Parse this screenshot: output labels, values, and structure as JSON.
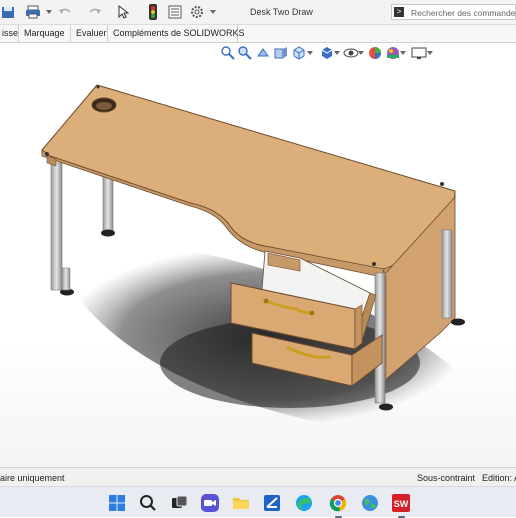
{
  "window": {
    "title": "Desk Two Draw",
    "search_placeholder": "Rechercher des commandes"
  },
  "toolbar_icons": [
    "save-icon",
    "print-icon",
    "undo-icon",
    "redo-icon",
    "select-arrow-icon",
    "rebuild-traffic-light-icon",
    "file-properties-icon",
    "options-gear-icon"
  ],
  "tabs": [
    {
      "label": "isse"
    },
    {
      "label": "Marquage"
    },
    {
      "label": "Evaluer"
    },
    {
      "label": "Compléments de SOLIDWORKS"
    }
  ],
  "headsup_icons": [
    "zoom-to-fit-icon",
    "zoom-to-area-icon",
    "previous-view-icon",
    "section-view-icon",
    "view-orientation-icon",
    "display-style-icon",
    "hide-show-items-icon",
    "edit-appearance-icon",
    "apply-scene-icon",
    "view-settings-icon"
  ],
  "model": {
    "name": "desk-with-two-drawers",
    "colors": {
      "wood_top": "#dcae7a",
      "wood_side": "#c99a64",
      "leg": "#c8c8c8",
      "shadow": "#1a1a1a",
      "handle": "#c9a020"
    }
  },
  "status": {
    "left": "aire uniquement",
    "middle": "Sous-contraint",
    "right": "Edition: A"
  },
  "taskbar_icons": [
    "windows-start-icon",
    "search-icon",
    "task-view-icon",
    "zoom-meetings-icon",
    "file-explorer-icon",
    "snipping-tool-icon",
    "edge-browser-icon",
    "chrome-browser-icon",
    "earth-globe-icon",
    "solidworks-app-icon"
  ]
}
